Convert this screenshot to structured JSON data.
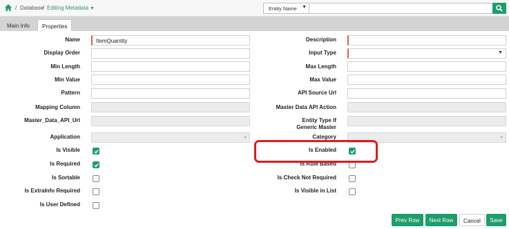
{
  "breadcrumb": {
    "sep": "/",
    "database": "Database",
    "editing": "Editing Metadata"
  },
  "search": {
    "entity_select_value": "Entity Name",
    "query": ""
  },
  "tabs": [
    {
      "label": "Main Info",
      "active": false
    },
    {
      "label": "Properties",
      "active": true
    }
  ],
  "form": {
    "name": {
      "label": "Name",
      "value": "ItemQuantity"
    },
    "description": {
      "label": "Description",
      "value": ""
    },
    "display_order": {
      "label": "Display Order",
      "value": ""
    },
    "input_type": {
      "label": "Input Type",
      "value": ""
    },
    "min_length": {
      "label": "Min Length",
      "value": ""
    },
    "max_length": {
      "label": "Max Length",
      "value": ""
    },
    "min_value": {
      "label": "Min Value",
      "value": ""
    },
    "max_value": {
      "label": "Max Value",
      "value": ""
    },
    "pattern": {
      "label": "Pattern",
      "value": ""
    },
    "api_source_url": {
      "label": "API Source Url",
      "value": ""
    },
    "mapping_column": {
      "label": "Mapping Column",
      "value": ""
    },
    "master_data_api_action": {
      "label": "Master Data API Action",
      "value": ""
    },
    "master_data_api_url": {
      "label": "Master_Data_API_Url",
      "value": ""
    },
    "entity_type_if_generic_master": {
      "label": "Entity Type If Generic Master",
      "value": ""
    },
    "application": {
      "label": "Application",
      "value": ""
    },
    "category": {
      "label": "Category",
      "value": ""
    }
  },
  "checks": {
    "is_visible": {
      "label": "Is Visible",
      "checked": true
    },
    "is_enabled": {
      "label": "Is Enabled",
      "checked": true
    },
    "is_required": {
      "label": "Is Required",
      "checked": true
    },
    "is_rule_based": {
      "label": "Is Rule Based",
      "checked": false
    },
    "is_sortable": {
      "label": "Is Sortable",
      "checked": false
    },
    "is_check_not_required": {
      "label": "Is Check Not Required",
      "checked": false
    },
    "is_extrainfo_required": {
      "label": "Is ExtraInfo Required",
      "checked": false
    },
    "is_visible_in_list": {
      "label": "Is Visible in List",
      "checked": false
    },
    "is_user_defined": {
      "label": "Is User Defined",
      "checked": false
    }
  },
  "buttons": {
    "prev_row": "Prev Row",
    "next_row": "Next Row",
    "cancel": "Cancel",
    "save": "Save"
  },
  "colors": {
    "accent": "#1e9d6b",
    "highlight": "#e01a1a",
    "required": "#e05a5a"
  },
  "icons": {
    "home": "home-icon",
    "search": "search-icon",
    "checkmark": "checkmark-icon",
    "dropdown": "chevron-down-icon"
  }
}
